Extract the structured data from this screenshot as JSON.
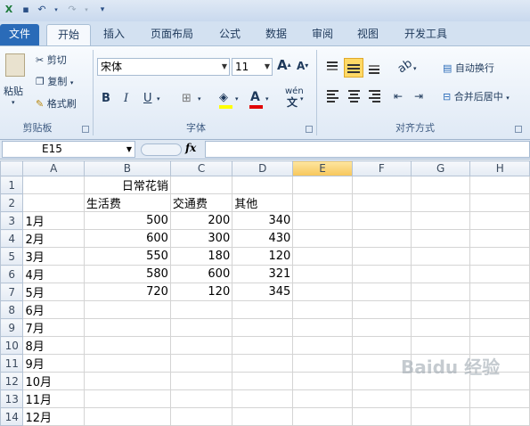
{
  "tabs": [
    "文件",
    "开始",
    "插入",
    "页面布局",
    "公式",
    "数据",
    "审阅",
    "视图",
    "开发工具"
  ],
  "clipboard": {
    "paste": "粘贴",
    "cut": "剪切",
    "copy": "复制",
    "format_painter": "格式刷",
    "label": "剪贴板"
  },
  "font": {
    "name": "宋体",
    "size": "11",
    "label": "字体",
    "grow": "A",
    "shrink": "A",
    "wen": "wén"
  },
  "alignment": {
    "wrap": "自动换行",
    "merge": "合并后居中",
    "label": "对齐方式"
  },
  "name_box": "E15",
  "fx": "fx",
  "columns": [
    "A",
    "B",
    "C",
    "D",
    "E",
    "F",
    "G",
    "H"
  ],
  "rows": [
    [
      "1",
      "",
      "日常花销",
      "",
      "",
      "",
      "",
      "",
      ""
    ],
    [
      "2",
      "",
      "生活费",
      "交通费",
      "其他",
      "",
      "",
      "",
      ""
    ],
    [
      "3",
      "1月",
      "500",
      "200",
      "340",
      "",
      "",
      "",
      ""
    ],
    [
      "4",
      "2月",
      "600",
      "300",
      "430",
      "",
      "",
      "",
      ""
    ],
    [
      "5",
      "3月",
      "550",
      "180",
      "120",
      "",
      "",
      "",
      ""
    ],
    [
      "6",
      "4月",
      "580",
      "600",
      "321",
      "",
      "",
      "",
      ""
    ],
    [
      "7",
      "5月",
      "720",
      "120",
      "345",
      "",
      "",
      "",
      ""
    ],
    [
      "8",
      "6月",
      "",
      "",
      "",
      "",
      "",
      "",
      ""
    ],
    [
      "9",
      "7月",
      "",
      "",
      "",
      "",
      "",
      "",
      ""
    ],
    [
      "10",
      "8月",
      "",
      "",
      "",
      "",
      "",
      "",
      ""
    ],
    [
      "11",
      "9月",
      "",
      "",
      "",
      "",
      "",
      "",
      ""
    ],
    [
      "12",
      "10月",
      "",
      "",
      "",
      "",
      "",
      "",
      ""
    ],
    [
      "13",
      "11月",
      "",
      "",
      "",
      "",
      "",
      "",
      ""
    ],
    [
      "14",
      "12月",
      "",
      "",
      "",
      "",
      "",
      "",
      ""
    ]
  ],
  "selected_column": "E",
  "watermark": "Baidu 经验"
}
